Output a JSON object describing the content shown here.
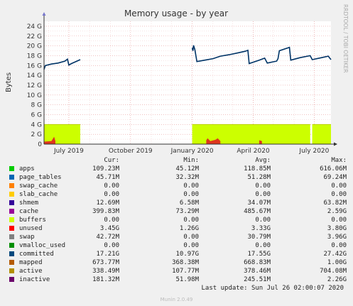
{
  "chart_data": {
    "type": "area",
    "title": "Memory usage - by year",
    "ylabel": "Bytes",
    "side_label": "RRDTOOL / TOBI OETIKER",
    "ylim": [
      0,
      25
    ],
    "y_ticks": [
      0,
      2,
      4,
      6,
      8,
      10,
      12,
      14,
      16,
      18,
      20,
      22,
      24
    ],
    "y_tick_labels": [
      "0",
      "2 G",
      "4 G",
      "6 G",
      "8 G",
      "10 G",
      "12 G",
      "14 G",
      "16 G",
      "18 G",
      "20 G",
      "22 G",
      "24 G"
    ],
    "x_ticks": [
      {
        "label": "July 2019",
        "date": "2019-07-01"
      },
      {
        "label": "October 2019",
        "date": "2019-10-01"
      },
      {
        "label": "January 2020",
        "date": "2020-01-01"
      },
      {
        "label": "April 2020",
        "date": "2020-04-01"
      },
      {
        "label": "July 2020",
        "date": "2020-07-01"
      }
    ],
    "xlim": [
      "2019-05-25",
      "2020-07-26"
    ],
    "grid": true,
    "series": [
      {
        "name": "unused",
        "color": "#ccff00",
        "segments": [
          {
            "from": "2019-05-25",
            "to": "2019-07-18",
            "value": 4.0
          },
          {
            "from": "2020-01-01",
            "to": "2020-06-25",
            "value": 4.0
          },
          {
            "from": "2020-06-28",
            "to": "2020-07-26",
            "value": 4.0
          }
        ]
      },
      {
        "name": "swap",
        "color": "#e02020",
        "points": [
          [
            "2019-05-25",
            0.5
          ],
          [
            "2019-06-05",
            0.6
          ],
          [
            "2019-06-09",
            1.5
          ],
          [
            "2019-06-11",
            0.6
          ],
          [
            "2019-07-18",
            0.5
          ],
          [
            "2020-01-01",
            0.5
          ],
          [
            "2020-01-22",
            0.8
          ],
          [
            "2020-01-24",
            1.2
          ],
          [
            "2020-01-28",
            0.6
          ],
          [
            "2020-02-05",
            0.9
          ],
          [
            "2020-02-08",
            1.2
          ],
          [
            "2020-02-12",
            0.6
          ],
          [
            "2020-04-10",
            0.8
          ],
          [
            "2020-04-14",
            0.6
          ],
          [
            "2020-07-26",
            0.4
          ]
        ]
      },
      {
        "name": "mapped",
        "color": "#cc6600",
        "points": [
          [
            "2019-05-25",
            0.7
          ],
          [
            "2019-07-18",
            0.7
          ],
          [
            "2020-01-01",
            0.7
          ],
          [
            "2020-07-26",
            0.6
          ]
        ]
      },
      {
        "name": "committed",
        "color": "#003366",
        "points": [
          [
            "2019-05-25",
            15.2
          ],
          [
            "2019-05-27",
            16.0
          ],
          [
            "2019-06-05",
            16.3
          ],
          [
            "2019-06-15",
            16.5
          ],
          [
            "2019-06-25",
            16.9
          ],
          [
            "2019-06-29",
            17.3
          ],
          [
            "2019-07-01",
            16.1
          ],
          [
            "2019-07-05",
            16.4
          ],
          [
            "2019-07-18",
            17.2
          ],
          [
            "2020-01-01",
            19.6
          ],
          [
            "2020-01-02",
            19.0
          ],
          [
            "2020-01-03",
            20.1
          ],
          [
            "2020-01-05",
            19.2
          ],
          [
            "2020-01-08",
            16.8
          ],
          [
            "2020-01-20",
            17.1
          ],
          [
            "2020-02-01",
            17.4
          ],
          [
            "2020-02-12",
            17.9
          ],
          [
            "2020-02-25",
            18.2
          ],
          [
            "2020-03-10",
            18.6
          ],
          [
            "2020-03-20",
            18.9
          ],
          [
            "2020-03-24",
            19.1
          ],
          [
            "2020-03-26",
            16.4
          ],
          [
            "2020-04-10",
            17.1
          ],
          [
            "2020-04-18",
            17.5
          ],
          [
            "2020-04-22",
            16.5
          ],
          [
            "2020-05-06",
            16.9
          ],
          [
            "2020-05-08",
            17.4
          ],
          [
            "2020-05-10",
            19.0
          ],
          [
            "2020-05-25",
            19.7
          ],
          [
            "2020-05-27",
            17.1
          ],
          [
            "2020-06-10",
            17.6
          ],
          [
            "2020-06-25",
            18.0
          ],
          [
            "2020-06-28",
            17.2
          ],
          [
            "2020-07-12",
            17.6
          ],
          [
            "2020-07-22",
            17.9
          ],
          [
            "2020-07-26",
            17.2
          ]
        ]
      }
    ]
  },
  "legend": {
    "headers": [
      "Cur:",
      "Min:",
      "Avg:",
      "Max:"
    ],
    "rows": [
      {
        "name": "apps",
        "color": "#00cc00",
        "cur": "109.23M",
        "min": "45.12M",
        "avg": "118.85M",
        "max": "616.06M"
      },
      {
        "name": "page_tables",
        "color": "#0066b3",
        "cur": "45.71M",
        "min": "32.32M",
        "avg": "51.28M",
        "max": "69.24M"
      },
      {
        "name": "swap_cache",
        "color": "#ff8000",
        "cur": "0.00",
        "min": "0.00",
        "avg": "0.00",
        "max": "0.00"
      },
      {
        "name": "slab_cache",
        "color": "#ffcc00",
        "cur": "0.00",
        "min": "0.00",
        "avg": "0.00",
        "max": "0.00"
      },
      {
        "name": "shmem",
        "color": "#330099",
        "cur": "12.69M",
        "min": "6.58M",
        "avg": "34.07M",
        "max": "63.82M"
      },
      {
        "name": "cache",
        "color": "#990099",
        "cur": "399.83M",
        "min": "73.29M",
        "avg": "485.67M",
        "max": "2.59G"
      },
      {
        "name": "buffers",
        "color": "#ccff00",
        "cur": "0.00",
        "min": "0.00",
        "avg": "0.00",
        "max": "0.00"
      },
      {
        "name": "unused",
        "color": "#ff0000",
        "cur": "3.45G",
        "min": "1.26G",
        "avg": "3.33G",
        "max": "3.80G"
      },
      {
        "name": "swap",
        "color": "#808080",
        "cur": "42.72M",
        "min": "0.00",
        "avg": "30.79M",
        "max": "3.96G"
      },
      {
        "name": "vmalloc_used",
        "color": "#008f00",
        "cur": "0.00",
        "min": "0.00",
        "avg": "0.00",
        "max": "0.00"
      },
      {
        "name": "committed",
        "color": "#00487d",
        "cur": "17.21G",
        "min": "10.97G",
        "avg": "17.55G",
        "max": "27.42G"
      },
      {
        "name": "mapped",
        "color": "#b35a00",
        "cur": "673.77M",
        "min": "368.38M",
        "avg": "668.83M",
        "max": "1.00G"
      },
      {
        "name": "active",
        "color": "#b38f00",
        "cur": "338.49M",
        "min": "107.77M",
        "avg": "378.46M",
        "max": "704.08M"
      },
      {
        "name": "inactive",
        "color": "#6b006b",
        "cur": "181.32M",
        "min": "51.98M",
        "avg": "245.51M",
        "max": "2.26G"
      }
    ]
  },
  "footer": {
    "last_update": "Last update: Sun Jul 26 02:00:07 2020",
    "munin_version": "Munin 2.0.49"
  }
}
